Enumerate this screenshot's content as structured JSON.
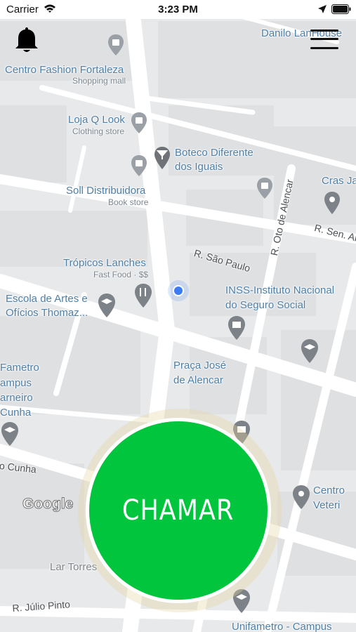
{
  "status_bar": {
    "carrier": "Carrier",
    "time": "3:23 PM"
  },
  "map": {
    "places": {
      "danilo": "Danilo LanHouse",
      "centro_fashion": "Centro Fashion Fortaleza",
      "centro_fashion_type": "Shopping mall",
      "loja_q_look": "Loja Q Look",
      "loja_q_look_type": "Clothing store",
      "boteco_1": "Boteco Diferente",
      "boteco_2": "dos Iguais",
      "cras": "Cras Ja",
      "soll": "Soll Distribuidora",
      "soll_type": "Book store",
      "tropicos": "Trópicos Lanches",
      "tropicos_type": "Fast Food · $$",
      "escola_1": "Escola de Artes e",
      "escola_2": "Ofícios Thomaz...",
      "inss_1": "INSS-Instituto Nacional",
      "inss_2": "do Seguro Social",
      "praca_1": "Praça José",
      "praca_2": "de Alencar",
      "unifametro_1": "Fametro",
      "unifametro_2": "ampus",
      "unifametro_3": "arneiro",
      "unifametro_4": "Cunha",
      "centro_vet_1": "Centro",
      "centro_vet_2": "Veteri",
      "lar_torres": "Lar Torres",
      "unifametro_bottom": "Unifametro - Campus"
    },
    "streets": {
      "sao_paulo": "R. São Paulo",
      "oto_alencar": "R. Oto de Alencar",
      "sen": "R. Sen. Al",
      "cunha": "o Cunha",
      "julio_pinto": "R. Júlio Pinto"
    },
    "attribution": "Google"
  },
  "call_button": {
    "label": "CHAMAR",
    "color": "#00c53d"
  },
  "icons": [
    "bell-icon",
    "hamburger-menu-icon",
    "wifi-icon",
    "location-arrow-icon",
    "battery-icon",
    "user-location-dot"
  ]
}
